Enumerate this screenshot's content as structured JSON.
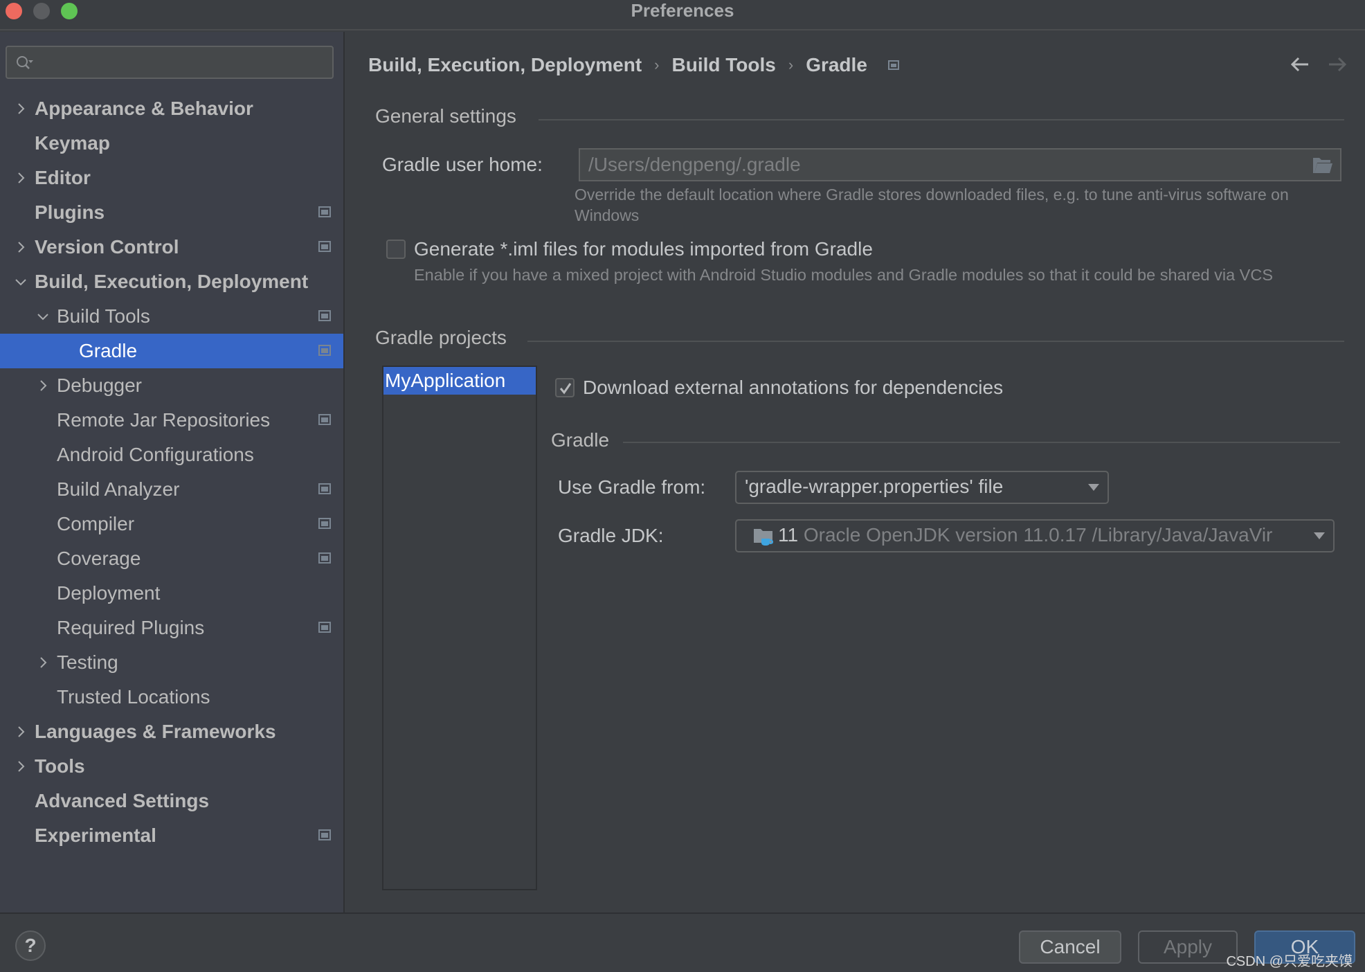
{
  "window": {
    "title": "Preferences"
  },
  "sidebar": {
    "search": {
      "value": "",
      "placeholder": ""
    },
    "items": [
      {
        "label": "Appearance & Behavior",
        "level": 0,
        "bold": true,
        "expandable": true,
        "expanded": false,
        "project_scoped": false
      },
      {
        "label": "Keymap",
        "level": 0,
        "bold": true,
        "expandable": false,
        "project_scoped": false
      },
      {
        "label": "Editor",
        "level": 0,
        "bold": true,
        "expandable": true,
        "expanded": false,
        "project_scoped": false
      },
      {
        "label": "Plugins",
        "level": 0,
        "bold": true,
        "expandable": false,
        "project_scoped": true
      },
      {
        "label": "Version Control",
        "level": 0,
        "bold": true,
        "expandable": true,
        "expanded": false,
        "project_scoped": true
      },
      {
        "label": "Build, Execution, Deployment",
        "level": 0,
        "bold": true,
        "expandable": true,
        "expanded": true,
        "project_scoped": false
      },
      {
        "label": "Build Tools",
        "level": 1,
        "bold": false,
        "expandable": true,
        "expanded": true,
        "project_scoped": true
      },
      {
        "label": "Gradle",
        "level": 2,
        "bold": false,
        "expandable": false,
        "project_scoped": true,
        "selected": true
      },
      {
        "label": "Debugger",
        "level": 1,
        "bold": false,
        "expandable": true,
        "expanded": false,
        "project_scoped": false
      },
      {
        "label": "Remote Jar Repositories",
        "level": 1,
        "bold": false,
        "expandable": false,
        "project_scoped": true
      },
      {
        "label": "Android Configurations",
        "level": 1,
        "bold": false,
        "expandable": false,
        "project_scoped": false
      },
      {
        "label": "Build Analyzer",
        "level": 1,
        "bold": false,
        "expandable": false,
        "project_scoped": true
      },
      {
        "label": "Compiler",
        "level": 1,
        "bold": false,
        "expandable": false,
        "project_scoped": true
      },
      {
        "label": "Coverage",
        "level": 1,
        "bold": false,
        "expandable": false,
        "project_scoped": true
      },
      {
        "label": "Deployment",
        "level": 1,
        "bold": false,
        "expandable": false,
        "project_scoped": false
      },
      {
        "label": "Required Plugins",
        "level": 1,
        "bold": false,
        "expandable": false,
        "project_scoped": true
      },
      {
        "label": "Testing",
        "level": 1,
        "bold": false,
        "expandable": true,
        "expanded": false,
        "project_scoped": false
      },
      {
        "label": "Trusted Locations",
        "level": 1,
        "bold": false,
        "expandable": false,
        "project_scoped": false
      },
      {
        "label": "Languages & Frameworks",
        "level": 0,
        "bold": true,
        "expandable": true,
        "expanded": false,
        "project_scoped": false
      },
      {
        "label": "Tools",
        "level": 0,
        "bold": true,
        "expandable": true,
        "expanded": false,
        "project_scoped": false
      },
      {
        "label": "Advanced Settings",
        "level": 0,
        "bold": true,
        "expandable": false,
        "project_scoped": false
      },
      {
        "label": "Experimental",
        "level": 0,
        "bold": true,
        "expandable": false,
        "project_scoped": true
      }
    ]
  },
  "breadcrumb": {
    "items": [
      "Build, Execution, Deployment",
      "Build Tools",
      "Gradle"
    ],
    "separator": "›",
    "icons": {
      "back": "arrow-left-icon",
      "forward": "arrow-right-icon"
    }
  },
  "general_settings": {
    "title": "General settings",
    "gradle_user_home": {
      "label": "Gradle user home:",
      "value": "/Users/dengpeng/.gradle",
      "hint": "Override the default location where Gradle stores downloaded files, e.g. to tune anti-virus software on Windows"
    },
    "generate_iml": {
      "label": "Generate *.iml files for modules imported from Gradle",
      "checked": false,
      "hint": "Enable if you have a mixed project with Android Studio modules and Gradle modules so that it could be shared via VCS"
    }
  },
  "gradle_projects": {
    "title": "Gradle projects",
    "projects": [
      "MyApplication"
    ],
    "selected_project": "MyApplication",
    "download_annotations": {
      "label": "Download external annotations for dependencies",
      "checked": true
    },
    "gradle_section": {
      "title": "Gradle",
      "use_gradle_from": {
        "label": "Use Gradle from:",
        "value": "'gradle-wrapper.properties' file"
      },
      "gradle_jdk": {
        "label": "Gradle JDK:",
        "version": "11",
        "value": "Oracle OpenJDK version 11.0.17 /Library/Java/JavaVir"
      }
    }
  },
  "footer": {
    "help_label": "?",
    "cancel_label": "Cancel",
    "apply_label": "Apply",
    "ok_label": "OK",
    "watermark": "CSDN @只爱吃夹馍"
  },
  "colors": {
    "accent": "#3766c6",
    "ok_button": "#365880",
    "background": "#3b3e42",
    "sidebar": "#3d4049"
  }
}
